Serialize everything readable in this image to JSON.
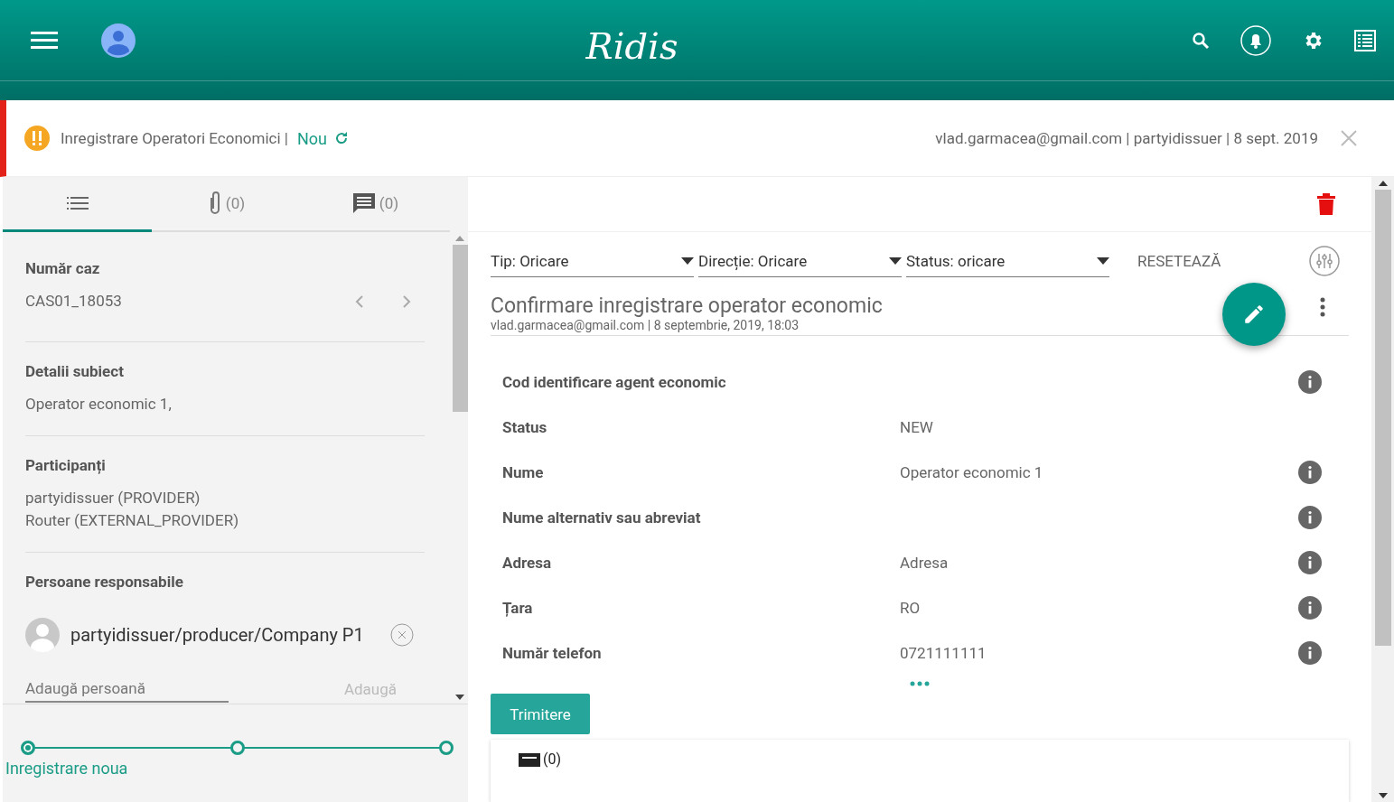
{
  "header": {
    "logo": "Ridis"
  },
  "banner": {
    "title": "Inregistrare Operatori Economici |",
    "status": "Nou",
    "meta": "vlad.garmacea@gmail.com | partyidissuer | 8 sept. 2019"
  },
  "left_tabs": [
    {
      "kind": "list",
      "selected": true
    },
    {
      "kind": "attachments",
      "count": "(0)",
      "selected": false
    },
    {
      "kind": "comments",
      "count": "(0)",
      "selected": false
    }
  ],
  "case": {
    "label": "Număr caz",
    "value": "CAS01_18053"
  },
  "subject": {
    "label": "Detalii subiect",
    "value": "Operator economic 1,"
  },
  "participants": {
    "label": "Participanți",
    "lines": [
      "partyidissuer (PROVIDER)",
      "Router (EXTERNAL_PROVIDER)"
    ]
  },
  "responsible": {
    "label": "Persoane responsabile",
    "people": [
      "partyidissuer/producer/Company P1"
    ],
    "add_placeholder": "Adaugă persoană",
    "add_button": "Adaugă"
  },
  "stepper": [
    {
      "label": "Inregistrare noua",
      "selected": true
    },
    {
      "selected": false
    },
    {
      "selected": false
    }
  ],
  "filters": [
    {
      "label": "Tip: Oricare"
    },
    {
      "label": "Direcție: Oricare"
    },
    {
      "label": "Status: oricare"
    }
  ],
  "reset": "RESETEAZĂ",
  "message": {
    "title": "Confirmare inregistrare operator economic",
    "meta": "vlad.garmacea@gmail.com | 8 septembrie, 2019, 18:03"
  },
  "fields": [
    {
      "label": "Cod identificare agent economic",
      "info": true
    },
    {
      "label": "Status",
      "value": "NEW",
      "info": false
    },
    {
      "label": "Nume",
      "value": "Operator economic 1",
      "info": true
    },
    {
      "label": "Nume alternativ sau abreviat",
      "info": true
    },
    {
      "label": "Adresa",
      "value": "Adresa",
      "info": true
    },
    {
      "label": "Țara",
      "value": "RO",
      "info": true
    },
    {
      "label": "Număr telefon",
      "value": "0721111111",
      "info": true
    }
  ],
  "submit": "Trimitere",
  "card": {
    "count": "(0)"
  }
}
